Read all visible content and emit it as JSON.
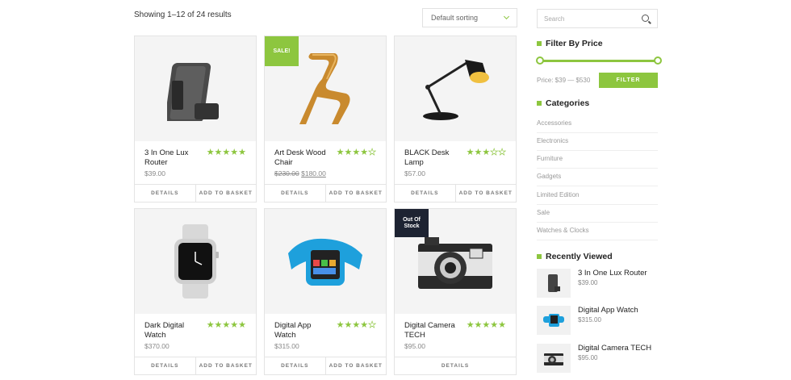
{
  "header": {
    "results_count": "Showing 1–12 of 24 results",
    "sort_selected": "Default sorting"
  },
  "products": [
    {
      "name": "3 In One Lux Router",
      "price": "$39.00",
      "old_price": "",
      "rating": 5,
      "badge": "",
      "image": "router-icon",
      "actions": [
        "DETAILS",
        "ADD TO BASKET"
      ]
    },
    {
      "name": "Art Desk Wood Chair",
      "price": "$180.00",
      "old_price": "$230.00",
      "rating": 4,
      "badge": "SALE!",
      "image": "chair-icon",
      "actions": [
        "DETAILS",
        "ADD TO BASKET"
      ]
    },
    {
      "name": "BLACK Desk Lamp",
      "price": "$57.00",
      "old_price": "",
      "rating": 3,
      "badge": "",
      "image": "lamp-icon",
      "actions": [
        "DETAILS",
        "ADD TO BASKET"
      ]
    },
    {
      "name": "Dark Digital Watch",
      "price": "$370.00",
      "old_price": "",
      "rating": 5,
      "badge": "",
      "image": "watch-icon",
      "actions": [
        "DETAILS",
        "ADD TO BASKET"
      ]
    },
    {
      "name": "Digital App Watch",
      "price": "$315.00",
      "old_price": "",
      "rating": 4,
      "badge": "",
      "image": "blue-watch-icon",
      "actions": [
        "DETAILS",
        "ADD TO BASKET"
      ]
    },
    {
      "name": "Digital Camera TECH",
      "price": "$95.00",
      "old_price": "",
      "rating": 5,
      "badge": "Out Of Stock",
      "image": "camera-icon",
      "actions": [
        "DETAILS"
      ]
    }
  ],
  "sidebar": {
    "search_placeholder": "Search",
    "filter_title": "Filter By Price",
    "price_range": "Price: $39 — $530",
    "filter_button": "FILTER",
    "categories_title": "Categories",
    "categories": [
      "Accessories",
      "Electronics",
      "Furniture",
      "Gadgets",
      "Limited Edition",
      "Sale",
      "Watches & Clocks"
    ],
    "recent_title": "Recently Viewed",
    "recent": [
      {
        "name": "3 In One Lux Router",
        "price": "$39.00",
        "image": "router-icon"
      },
      {
        "name": "Digital App Watch",
        "price": "$315.00",
        "image": "blue-watch-icon"
      },
      {
        "name": "Digital Camera TECH",
        "price": "$95.00",
        "image": "camera-icon"
      }
    ]
  },
  "colors": {
    "accent": "#8dc63f",
    "dark_badge": "#1d2332"
  }
}
